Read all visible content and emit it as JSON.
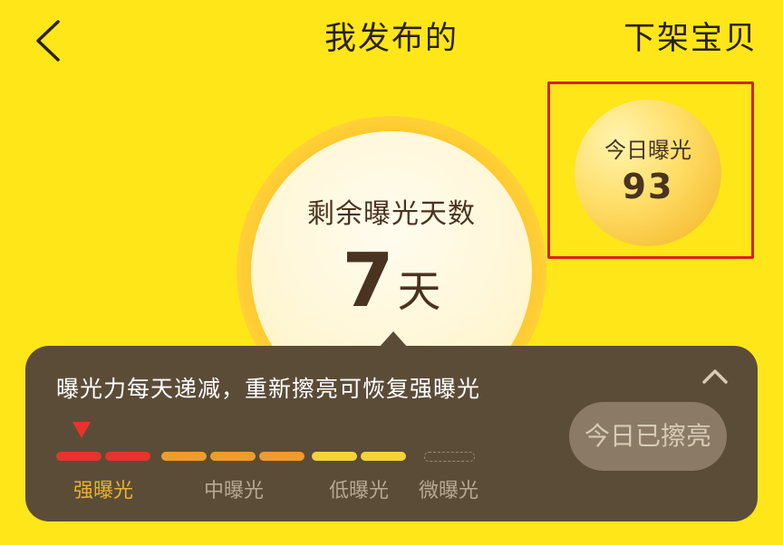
{
  "header": {
    "title": "我发布的",
    "right_action": "下架宝贝"
  },
  "exposure": {
    "remaining_label": "剩余曝光天数",
    "remaining_value": "7",
    "remaining_unit": "天",
    "today_label": "今日曝光",
    "today_value": "93"
  },
  "panel": {
    "message": "曝光力每天递减，重新擦亮可恢复强曝光",
    "rub_button": "今日已擦亮",
    "current_level": "强曝光",
    "levels": [
      {
        "label": "强曝光",
        "color": "#E8332C",
        "label_color": "#E9B330"
      },
      {
        "label": "中曝光",
        "color": "#F29A2E",
        "label_color": "#B7A893"
      },
      {
        "label": "低曝光",
        "color": "#F5D23A",
        "label_color": "#B7A893"
      },
      {
        "label": "微曝光",
        "color": "#9A8C78",
        "label_color": "#B7A893"
      }
    ]
  },
  "colors": {
    "background": "#FFE619",
    "panel": "#5B4C38",
    "highlight_border": "#D9231B"
  },
  "icons": {
    "back": "chevron-left-icon",
    "collapse": "chevron-up-icon",
    "marker": "triangle-down-icon"
  }
}
